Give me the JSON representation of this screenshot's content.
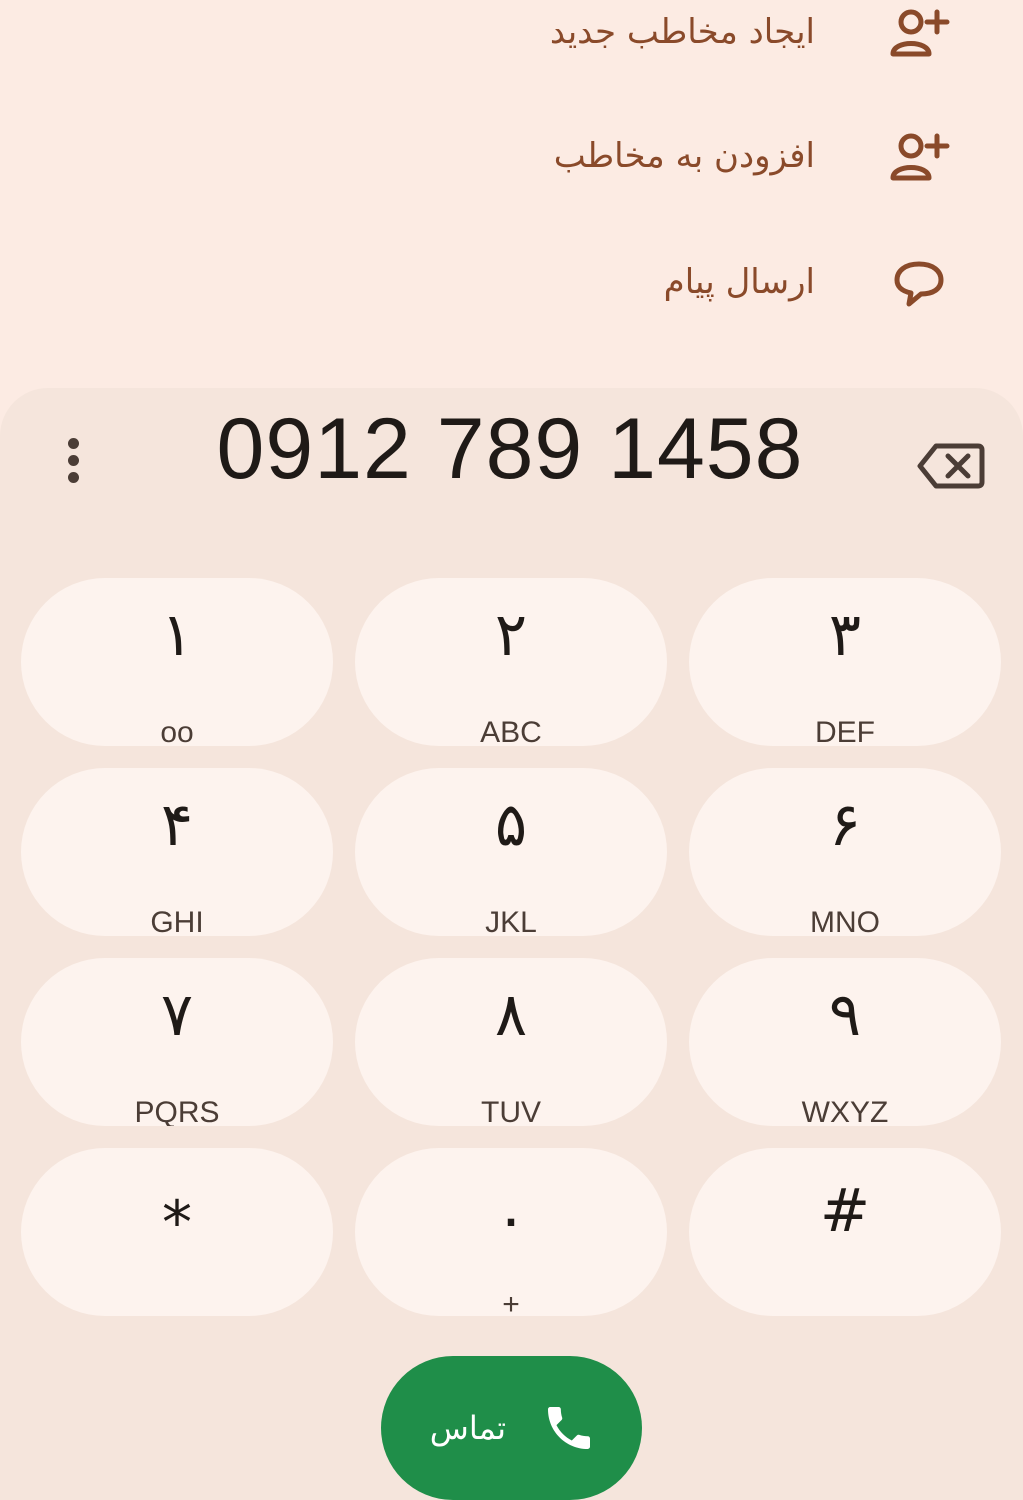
{
  "actions": [
    {
      "label": "ایجاد مخاطب جدید",
      "icon": "person-add-icon"
    },
    {
      "label": "افزودن به مخاطب",
      "icon": "person-add-icon"
    },
    {
      "label": "ارسال پیام",
      "icon": "message-icon"
    }
  ],
  "dialer": {
    "number": "0912 789 1458",
    "keys": [
      {
        "digit": "۱",
        "letters": "ᴏᴏ"
      },
      {
        "digit": "۲",
        "letters": "ABC"
      },
      {
        "digit": "۳",
        "letters": "DEF"
      },
      {
        "digit": "۴",
        "letters": "GHI"
      },
      {
        "digit": "۵",
        "letters": "JKL"
      },
      {
        "digit": "۶",
        "letters": "MNO"
      },
      {
        "digit": "۷",
        "letters": "PQRS"
      },
      {
        "digit": "۸",
        "letters": "TUV"
      },
      {
        "digit": "۹",
        "letters": "WXYZ"
      },
      {
        "digit": "*",
        "letters": ""
      },
      {
        "digit": "۰",
        "letters": "+"
      },
      {
        "digit": "#",
        "letters": ""
      }
    ],
    "call_label": "تماس"
  },
  "colors": {
    "accent_brown": "#8a4a2a",
    "call_green": "#1f8e49"
  }
}
